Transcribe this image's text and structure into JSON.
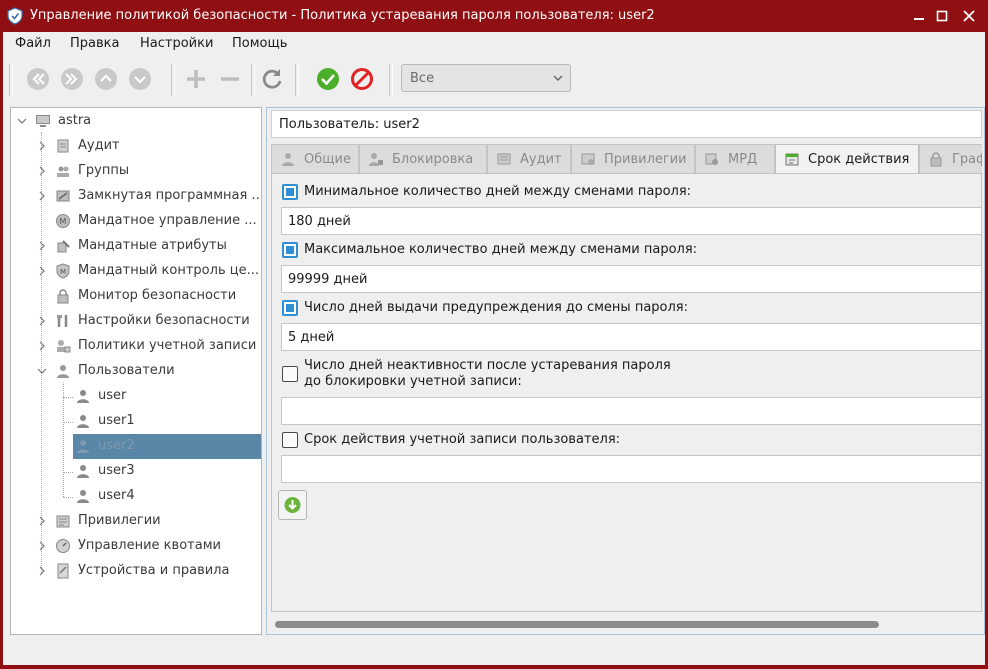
{
  "window": {
    "title": "Управление политикой безопасности - Политика устаревания пароля пользователя: user2"
  },
  "menu": [
    "Файл",
    "Правка",
    "Настройки",
    "Помощь"
  ],
  "toolbar": {
    "icons": [
      "first-icon",
      "last-icon",
      "up-icon",
      "down-icon",
      "add-icon",
      "remove-icon",
      "refresh-icon",
      "apply-icon",
      "cancel-icon"
    ],
    "filter_value": "Все"
  },
  "tree": {
    "root": "astra",
    "items": [
      "Аудит",
      "Группы",
      "Замкнутая программная ...",
      "Мандатное управление ...",
      "Мандатные атрибуты",
      "Мандатный контроль це...",
      "Монитор безопасности",
      "Настройки безопасности",
      "Политики учетной записи",
      "Пользователи",
      "user",
      "user1",
      "user2",
      "user3",
      "user4",
      "Привилегии",
      "Управление квотами",
      "Устройства и правила"
    ],
    "selected": "user2"
  },
  "user_field": "Пользователь: user2",
  "tabs": [
    "Общие",
    "Блокировка",
    "Аудит",
    "Привилегии",
    "МРД",
    "Срок действия",
    "Граф"
  ],
  "active_tab": "Срок действия",
  "panel": {
    "min_days_label": "Минимальное количество дней между сменами пароля:",
    "min_days_checked": true,
    "min_days_value": "180 дней",
    "max_days_label": "Максимальное количество дней между сменами пароля:",
    "max_days_checked": true,
    "max_days_value": "99999 дней",
    "warn_days_label": "Число дней выдачи предупреждения до смены пароля:",
    "warn_days_checked": true,
    "warn_days_value": "5 дней",
    "inactive_label_1": "Число дней неактивности после устаревания пароля",
    "inactive_label_2": "до блокировки учетной записи:",
    "inactive_checked": false,
    "inactive_value": "",
    "expire_label": "Срок действия учетной записи пользователя:",
    "expire_checked": false,
    "expire_value": ""
  },
  "colors": {
    "titlebar": "#8f0f12",
    "selection": "#5a87a8",
    "checkbox": "#2f8fd2",
    "apply": "#4caf2a",
    "cancel": "#e02424"
  }
}
